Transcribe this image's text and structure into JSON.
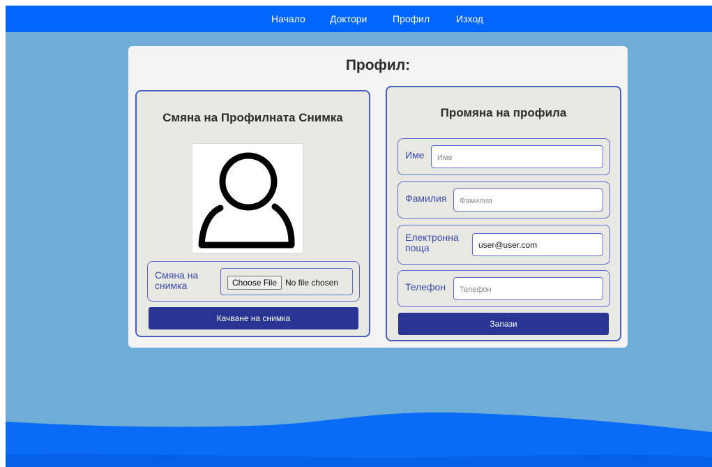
{
  "nav": {
    "items": [
      {
        "label": "Начало"
      },
      {
        "label": "Доктори"
      },
      {
        "label": "Профил"
      },
      {
        "label": "Изход"
      }
    ]
  },
  "card": {
    "title": "Профил:"
  },
  "photo_panel": {
    "title": "Смяна на Профилната Снимка",
    "avatar_icon": "user-silhouette-icon",
    "file_label": "Смяна на снимка",
    "file_button": "Choose File",
    "file_status": "No file chosen",
    "upload_button": "Качване на снимка"
  },
  "profile_panel": {
    "title": "Промяна на профила",
    "fields": {
      "first_name": {
        "label": "Име",
        "placeholder": "Име",
        "value": ""
      },
      "last_name": {
        "label": "Фамилия",
        "placeholder": "Фамилия",
        "value": ""
      },
      "email": {
        "label": "Електронна поща",
        "placeholder": "",
        "value": "user@user.com"
      },
      "phone": {
        "label": "Телефон",
        "placeholder": "Телефон",
        "value": ""
      }
    },
    "save_button": "Запази"
  },
  "colors": {
    "navbar": "#0066ff",
    "background": "#6fadd9",
    "panel_border": "#4a5cc0",
    "button": "#283593"
  }
}
